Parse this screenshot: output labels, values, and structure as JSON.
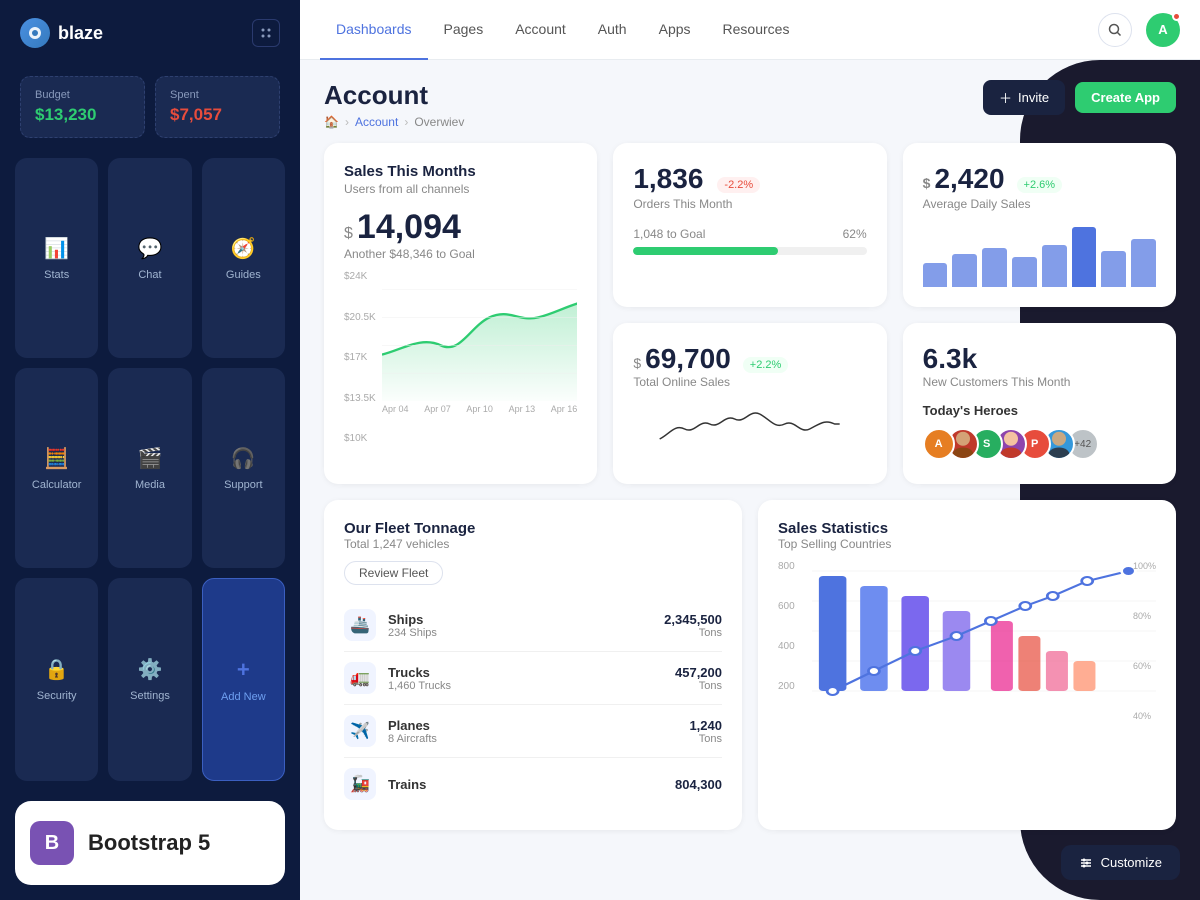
{
  "app": {
    "name": "blaze"
  },
  "sidebar": {
    "budget_label": "Budget",
    "budget_value": "$13,230",
    "spent_label": "Spent",
    "spent_value": "$7,057",
    "nav_items": [
      {
        "id": "stats",
        "label": "Stats",
        "icon": "📊"
      },
      {
        "id": "chat",
        "label": "Chat",
        "icon": "💬"
      },
      {
        "id": "guides",
        "label": "Guides",
        "icon": "🧭"
      },
      {
        "id": "calculator",
        "label": "Calculator",
        "icon": "🧮"
      },
      {
        "id": "media",
        "label": "Media",
        "icon": "🎬"
      },
      {
        "id": "support",
        "label": "Support",
        "icon": "🎧"
      },
      {
        "id": "security",
        "label": "Security",
        "icon": "🔒"
      },
      {
        "id": "settings",
        "label": "Settings",
        "icon": "⚙️"
      },
      {
        "id": "add-new",
        "label": "Add New",
        "icon": "+",
        "active": true
      }
    ],
    "bootstrap_label": "Bootstrap 5"
  },
  "topnav": {
    "items": [
      {
        "id": "dashboards",
        "label": "Dashboards",
        "active": true
      },
      {
        "id": "pages",
        "label": "Pages"
      },
      {
        "id": "account",
        "label": "Account"
      },
      {
        "id": "auth",
        "label": "Auth"
      },
      {
        "id": "apps",
        "label": "Apps"
      },
      {
        "id": "resources",
        "label": "Resources"
      }
    ]
  },
  "page": {
    "title": "Account",
    "breadcrumb": [
      "Home",
      "Account",
      "Overwiev"
    ],
    "actions": {
      "invite_label": "Invite",
      "create_label": "Create App"
    }
  },
  "stats": {
    "orders": {
      "value": "1,836",
      "label": "Orders This Month",
      "change": "-2.2%",
      "change_type": "down",
      "goal_label": "1,048 to Goal",
      "goal_pct": 62,
      "goal_pct_label": "62%"
    },
    "daily_sales": {
      "prefix": "$",
      "value": "2,420",
      "label": "Average Daily Sales",
      "change": "+2.6%",
      "change_type": "up",
      "bars": [
        40,
        55,
        65,
        50,
        70,
        85,
        60,
        75
      ]
    },
    "sales_month": {
      "title": "Sales This Months",
      "sub": "Users from all channels",
      "prefix": "$",
      "value": "14,094",
      "goal_label": "Another $48,346 to Goal",
      "y_labels": [
        "$24K",
        "$20.5K",
        "$17K",
        "$13.5K",
        "$10K"
      ],
      "x_labels": [
        "Apr 04",
        "Apr 07",
        "Apr 10",
        "Apr 13",
        "Apr 16"
      ]
    },
    "online_sales": {
      "prefix": "$",
      "value": "69,700",
      "label": "Total Online Sales",
      "change": "+2.2%",
      "change_type": "up"
    },
    "new_customers": {
      "value": "6.3k",
      "label": "New Customers This Month",
      "heroes_label": "Today's Heroes",
      "hero_count_extra": "+42"
    }
  },
  "fleet": {
    "title": "Our Fleet Tonnage",
    "sub": "Total 1,247 vehicles",
    "review_btn": "Review Fleet",
    "items": [
      {
        "icon": "🚢",
        "name": "Ships",
        "count": "234 Ships",
        "amount": "2,345,500",
        "unit": "Tons"
      },
      {
        "icon": "🚛",
        "name": "Trucks",
        "count": "1,460 Trucks",
        "amount": "457,200",
        "unit": "Tons"
      },
      {
        "icon": "✈️",
        "name": "Planes",
        "count": "8 Aircrafts",
        "amount": "1,240",
        "unit": "Tons"
      },
      {
        "icon": "🚂",
        "name": "Trains",
        "count": "",
        "amount": "804,300",
        "unit": ""
      }
    ]
  },
  "sales_stats": {
    "title": "Sales Statistics",
    "sub": "Top Selling Countries",
    "y_labels": [
      "800",
      "600",
      "400",
      "200",
      ""
    ],
    "pct_labels": [
      "100%",
      "80%",
      "60%",
      "40%"
    ]
  },
  "customize": {
    "label": "Customize"
  }
}
